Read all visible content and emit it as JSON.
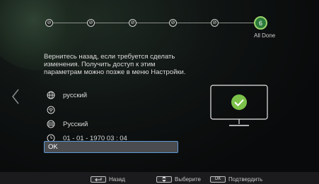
{
  "steps": {
    "items": [
      "⊘",
      "⊘",
      "⊘",
      "⊘",
      "⊘"
    ],
    "active_number": "6",
    "active_label": "All Done"
  },
  "message": "Вернитесь назад, если требуется сделать изменения. Получить доступ к этим параметрам можно позже в меню Настройки.",
  "summary": {
    "items": [
      {
        "icon": "globe-icon",
        "text": "русский"
      },
      {
        "icon": "wifi-icon",
        "text": ""
      },
      {
        "icon": "subtitle-icon",
        "text": "Русский"
      },
      {
        "icon": "clock-icon",
        "text": "01 - 01 - 1970 03 : 04"
      }
    ]
  },
  "ok_button": {
    "label": "OK"
  },
  "hints": {
    "back_label": "Назад",
    "select_label": "Выберите",
    "confirm_key": "OK",
    "confirm_label": "Подтвердить"
  },
  "colors": {
    "accent_green": "#2b7a3a",
    "focus_border": "#5f9ad6",
    "check_green": "#7cc24a"
  }
}
